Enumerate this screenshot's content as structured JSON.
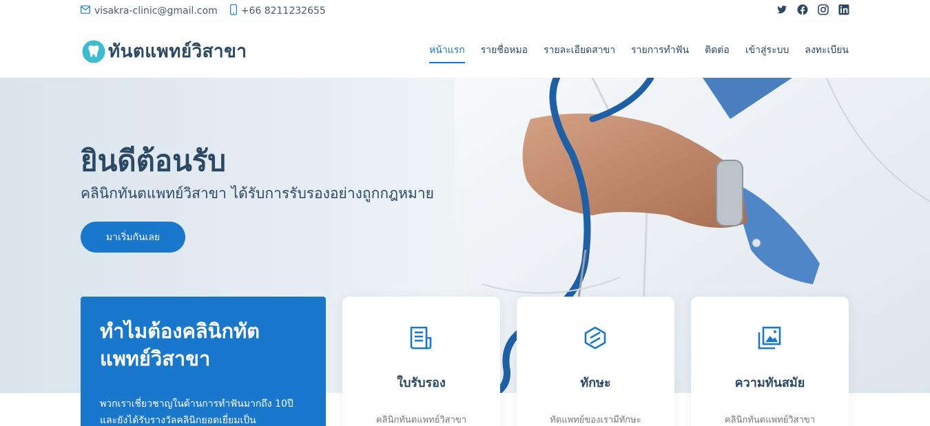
{
  "topbar": {
    "email": "visakra-clinic@gmail.com",
    "phone": "+66 8211232655",
    "social": [
      "twitter-icon",
      "facebook-icon",
      "instagram-icon",
      "linkedin-icon"
    ]
  },
  "header": {
    "brand": "ทันตแพทย์วิสาขา",
    "nav": [
      {
        "label": "หน้าแรก",
        "active": true
      },
      {
        "label": "รายชื่อหมอ"
      },
      {
        "label": "รายละเอียดสาขา"
      },
      {
        "label": "รายการทำฟัน"
      },
      {
        "label": "ติดต่อ"
      },
      {
        "label": "เข้าสู่ระบบ"
      },
      {
        "label": "ลงทะเบียน"
      }
    ]
  },
  "hero": {
    "title": "ยินดีต้อนรับ",
    "subtitle": "คลินิกทันตแพทย์วิสาขา ได้รับการรับรองอย่างถูกกฎหมาย",
    "cta": "มาเริ่มกันเลย"
  },
  "why": {
    "title": "ทำไมต้องคลินิกทัตแพทย์วิสาขา",
    "text": "พวกเราเชี่ยวชาญในด้านการทำฟันมากถึง 10ปี และยังได้รับรางวัลคลินิกยอดเยี่ยมเป็น"
  },
  "cards": [
    {
      "icon": "document-icon",
      "title": "ใบรับรอง",
      "text": "คลินิกทันตแพทย์วิสาขา"
    },
    {
      "icon": "cube-icon",
      "title": "ทักษะ",
      "text": "ทัตแพทย์ของเรามีทักษะ"
    },
    {
      "icon": "images-icon",
      "title": "ความทันสมัย",
      "text": "คลินิกทันตแพทย์วิสาขา"
    }
  ],
  "colors": {
    "accent": "#1977cc",
    "text": "#2c4964"
  }
}
